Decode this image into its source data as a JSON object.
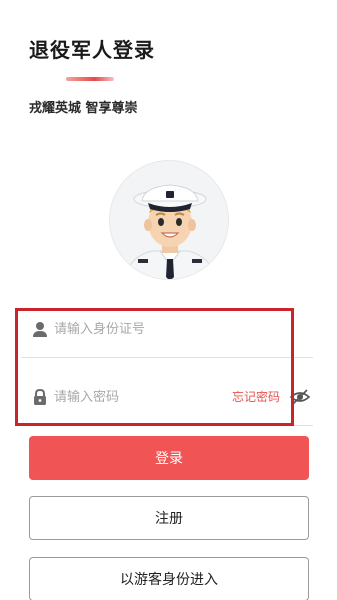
{
  "header": {
    "title": "退役军人登录",
    "subtitle": "戎耀英城 智享尊崇"
  },
  "form": {
    "id_placeholder": "请输入身份证号",
    "id_value": "",
    "password_placeholder": "请输入密码",
    "password_value": "",
    "forgot_label": "忘记密码"
  },
  "buttons": {
    "login_label": "登录",
    "register_label": "注册",
    "guest_label": "以游客身份进入"
  },
  "icons": {
    "user": "user-icon",
    "lock": "lock-icon",
    "eye": "eye-slash-icon",
    "avatar": "sailor-avatar"
  },
  "colors": {
    "accent": "#f05454",
    "forgot": "#e8534f",
    "highlight": "#c8242a"
  }
}
